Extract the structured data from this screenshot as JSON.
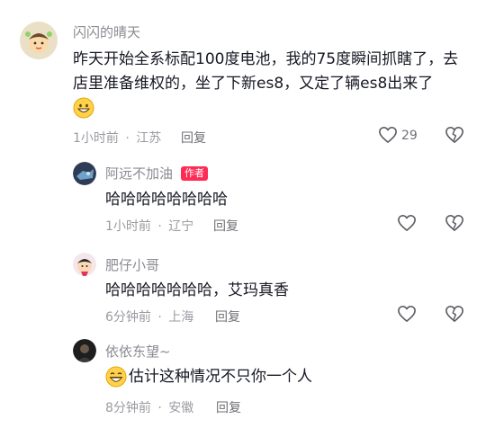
{
  "comments": [
    {
      "username": "闪闪的晴天",
      "text_line1": "昨天开始全系标配100度电池，我的75度瞬间抓瞎了，去",
      "text_line2": "店里准备维权的，坐了下新es8，又定了辆es8出来了",
      "time": "1小时前",
      "location": "江苏",
      "reply": "回复",
      "likes": "29"
    }
  ],
  "replies": [
    {
      "username": "阿远不加油",
      "badge": "作者",
      "text": "哈哈哈哈哈哈哈哈",
      "time": "1小时前",
      "location": "辽宁",
      "reply": "回复"
    },
    {
      "username": "肥仔小哥",
      "text": "哈哈哈哈哈哈哈，艾玛真香",
      "time": "6分钟前",
      "location": "上海",
      "reply": "回复"
    },
    {
      "username": "依依东望~",
      "text": "估计这种情况不只你一个人",
      "time": "8分钟前",
      "location": "安徽",
      "reply": "回复"
    }
  ],
  "separator": "·",
  "watermark": "",
  "icons": [
    "heart-icon",
    "dislike-icon",
    "grin-emoji-icon",
    "laugh-emoji-icon"
  ]
}
